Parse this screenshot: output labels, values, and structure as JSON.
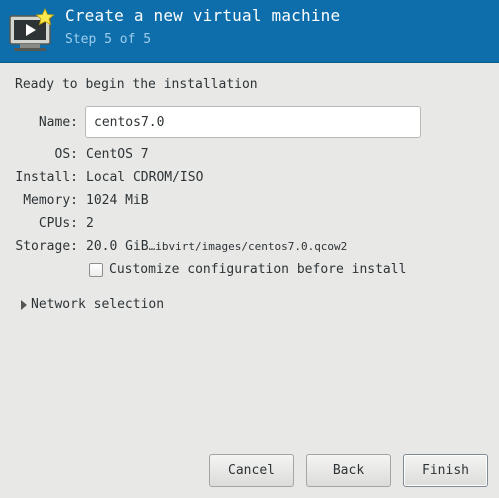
{
  "header": {
    "title": "Create a new virtual machine",
    "step": "Step 5 of 5",
    "icon": "virtual-machine-new-icon"
  },
  "intro": "Ready to begin the installation",
  "fields": {
    "name_label": "Name:",
    "name_value": "centos7.0",
    "os_label": "OS:",
    "os_value": "CentOS 7",
    "install_label": "Install:",
    "install_value": "Local CDROM/ISO",
    "memory_label": "Memory:",
    "memory_value": "1024 MiB",
    "cpus_label": "CPUs:",
    "cpus_value": "2",
    "storage_label": "Storage:",
    "storage_size": "20.0 GiB",
    "storage_path": "…ibvirt/images/centos7.0.qcow2"
  },
  "customize": {
    "label": "Customize configuration before install",
    "checked": false
  },
  "network": {
    "label": "Network selection",
    "expanded": false
  },
  "buttons": {
    "cancel": "Cancel",
    "back": "Back",
    "finish": "Finish"
  },
  "colors": {
    "header_bg": "#0d6eab",
    "step_text": "#9ecdec",
    "window_bg": "#e8e8e7"
  }
}
